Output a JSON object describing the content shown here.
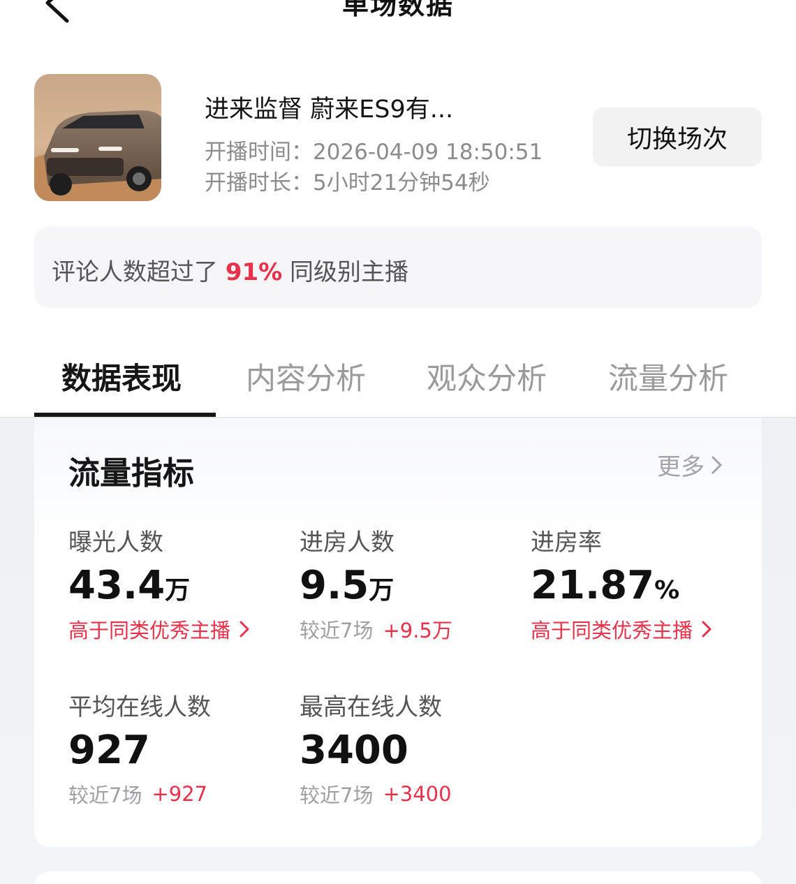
{
  "header": {
    "title": "单场数据"
  },
  "session": {
    "title": "进来监督 蔚来ES9有...",
    "start_time": "开播时间：2026-04-09 18:50:51",
    "duration": "开播时长：5小时21分钟54秒",
    "switch_label": "切换场次"
  },
  "rank": {
    "prefix": "评论人数超过了 ",
    "percent": "91%",
    "suffix": " 同级别主播"
  },
  "tabs": [
    {
      "label": "数据表现"
    },
    {
      "label": "内容分析"
    },
    {
      "label": "观众分析"
    },
    {
      "label": "流量分析"
    }
  ],
  "traffic": {
    "title": "流量指标",
    "more_label": "更多",
    "metrics": [
      {
        "label": "曝光人数",
        "value": "43.4",
        "unit": "万",
        "note": "高于同类优秀主播"
      },
      {
        "label": "进房人数",
        "value": "9.5",
        "unit": "万",
        "compare": "较近7场",
        "delta": "+9.5万"
      },
      {
        "label": "进房率",
        "value": "21.87",
        "unit": "%",
        "note": "高于同类优秀主播"
      },
      {
        "label": "平均在线人数",
        "value": "927",
        "compare": "较近7场",
        "delta": "+927"
      },
      {
        "label": "最高在线人数",
        "value": "3400",
        "compare": "较近7场",
        "delta": "+3400"
      }
    ]
  },
  "colors": {
    "accent": "#e8324b",
    "tab_active": "#161616",
    "muted": "#9a9a9a"
  }
}
